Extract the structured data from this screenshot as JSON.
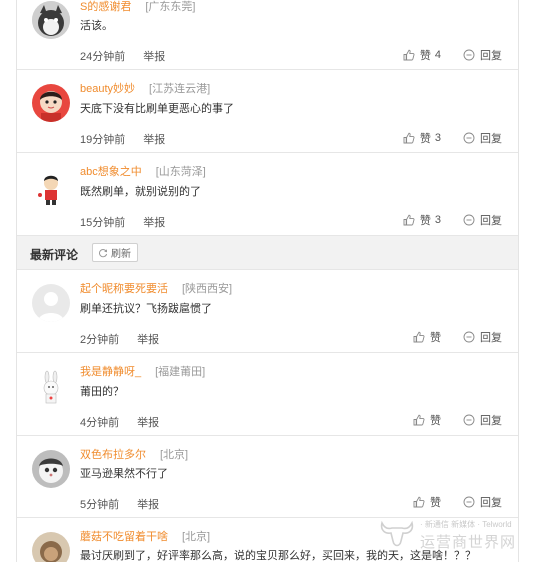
{
  "comments_top": [
    {
      "username": "S的感谢君",
      "location": "[广东东莞]",
      "text": "活该。",
      "time": "24分钟前",
      "report": "举报",
      "like_label": "赞",
      "like_count": "4",
      "reply": "回复"
    },
    {
      "username": "beauty妙妙",
      "location": "[江苏连云港]",
      "text": "天底下没有比刷单更恶心的事了",
      "time": "19分钟前",
      "report": "举报",
      "like_label": "赞",
      "like_count": "3",
      "reply": "回复"
    },
    {
      "username": "abc想象之中",
      "location": "[山东菏泽]",
      "text": "既然刷单，就别说别的了",
      "time": "15分钟前",
      "report": "举报",
      "like_label": "赞",
      "like_count": "3",
      "reply": "回复"
    }
  ],
  "latest_section": {
    "title": "最新评论",
    "refresh": "刷新"
  },
  "comments_latest": [
    {
      "username": "起个昵称要死要活",
      "location": "[陕西西安]",
      "text": "刷单还抗议？飞扬跋扈惯了",
      "time": "2分钟前",
      "report": "举报",
      "like_label": "赞",
      "reply": "回复"
    },
    {
      "username": "我是静静呀_",
      "location": "[福建莆田]",
      "text": "莆田的？",
      "time": "4分钟前",
      "report": "举报",
      "like_label": "赞",
      "reply": "回复"
    },
    {
      "username": "双色布拉多尔",
      "location": "[北京]",
      "text": "亚马逊果然不行了",
      "time": "5分钟前",
      "report": "举报",
      "like_label": "赞",
      "reply": "回复"
    },
    {
      "username": "蘑菇不吃留着干啥",
      "location": "[北京]",
      "text": "最讨厌刷到了，好评率那么高，说的宝贝那么好，买回来，我的天，这是啥！？？"
    }
  ],
  "watermark": {
    "line1": "· 新通信 新媒体 · Telworld",
    "line2": "运营商世界网"
  },
  "icons": {
    "like": "thumbs-up-icon",
    "reply": "reply-icon",
    "refresh": "refresh-icon",
    "watermark_logo": "bull-logo-icon"
  },
  "colors": {
    "username": "#f08c2e",
    "location": "#999999",
    "section_bg": "#f2f2f2"
  }
}
